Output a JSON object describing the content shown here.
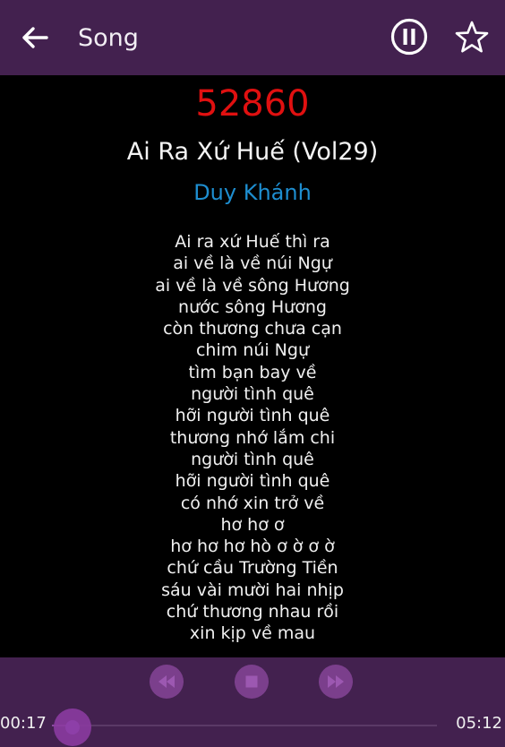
{
  "appbar": {
    "title": "Song",
    "back_icon": "arrow-left-icon",
    "pause_icon": "pause-circle-icon",
    "favorite_icon": "star-outline-icon",
    "color": "#43214f"
  },
  "song": {
    "code": "52860",
    "title": "Ai Ra Xứ Huế (Vol29)",
    "artist": "Duy Khánh",
    "lyrics": [
      "Ai ra xứ Huế thì ra",
      "ai về là về núi Ngự",
      "ai về là về sông Hương",
      "nước sông Hương",
      "còn thương chưa cạn",
      "chim núi Ngự",
      "tìm bạn bay về",
      "người tình quê",
      "hỡi người tình quê",
      "thương nhớ lắm chi",
      "người tình quê",
      "hỡi người tình quê",
      "có nhớ xin trở về",
      "hơ hơ ơ",
      "hơ hơ hơ hò ơ ờ ơ ờ",
      "chứ cầu Trường Tiền",
      "sáu vài mười hai nhịp",
      "chứ thương nhau rồi",
      "xin kịp về mau"
    ],
    "code_color": "#e01010",
    "artist_color": "#1e8ed0"
  },
  "player": {
    "controls": [
      {
        "name": "rewind-button",
        "icon": "rewind-icon"
      },
      {
        "name": "stop-button",
        "icon": "stop-icon"
      },
      {
        "name": "fast-forward-button",
        "icon": "fast-forward-icon"
      }
    ],
    "elapsed": "00:17",
    "total": "05:12",
    "progress": 0.054
  }
}
